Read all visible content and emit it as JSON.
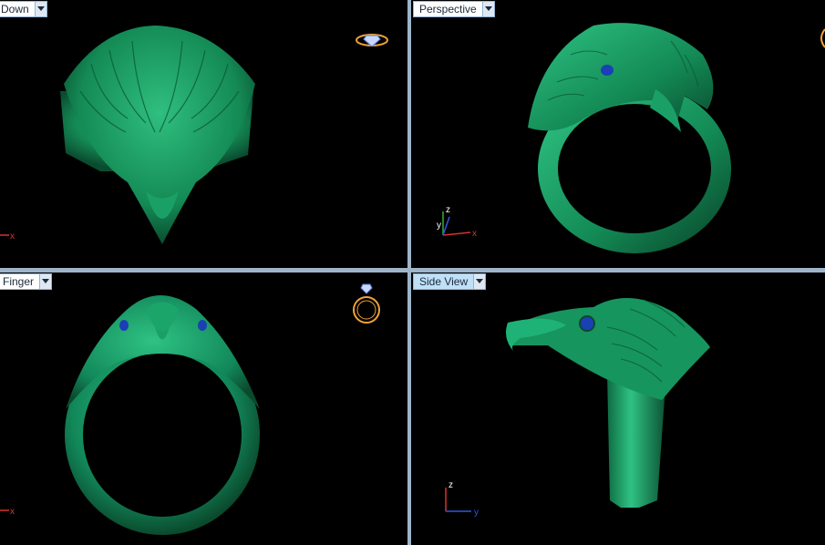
{
  "viewports": {
    "top_left": {
      "label": "Down",
      "tab_bg": "#ffffff"
    },
    "top_right": {
      "label": "Perspective",
      "tab_bg": "#ffffff"
    },
    "bottom_left": {
      "label": "Finger",
      "tab_bg": "#ffffff"
    },
    "bottom_right": {
      "label": "Side View",
      "tab_bg": "#bfe0f7"
    }
  },
  "axes": {
    "x": "x",
    "y": "y",
    "z": "z"
  },
  "colors": {
    "ring_green": "#17955e",
    "ring_highlight": "#3fd08f",
    "ring_shadow": "#0b4a2e",
    "eye_blue": "#1b3fb5",
    "widget_orange": "#f0a23a",
    "axis_red": "#d8332c",
    "axis_green": "#2fae3c",
    "axis_blue": "#2b5be0"
  },
  "icons": {
    "viewport_menu": "chevron-down-icon",
    "view_widget_down": "diamond-ring-top-icon",
    "view_widget_finger": "ring-front-icon"
  }
}
